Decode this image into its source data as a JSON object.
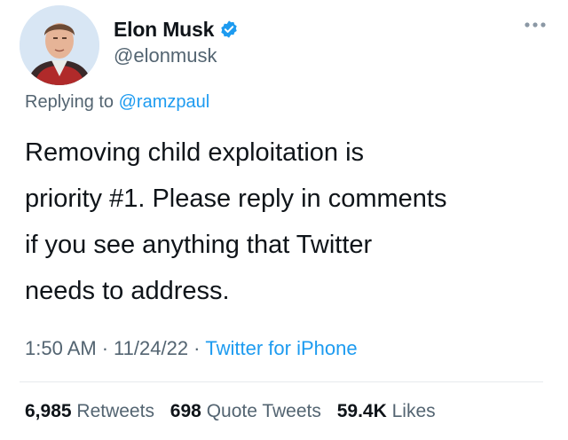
{
  "author": {
    "display_name": "Elon Musk",
    "handle": "@elonmusk",
    "verified_icon": "verified-badge-icon",
    "avatar_icon": "profile-photo"
  },
  "reply": {
    "prefix": "Replying to",
    "mention": "@ramzpaul"
  },
  "tweet": {
    "lines": [
      "Removing child exploitation is",
      "priority #1. Please reply in comments",
      "if you see anything that Twitter",
      "needs to address."
    ]
  },
  "meta": {
    "time": "1:50 AM",
    "date": "11/24/22",
    "separator": "·",
    "source": "Twitter for iPhone"
  },
  "stats": {
    "retweets_count": "6,985",
    "retweets_label": "Retweets",
    "quotes_count": "698",
    "quotes_label": "Quote Tweets",
    "likes_count": "59.4K",
    "likes_label": "Likes"
  },
  "colors": {
    "accent": "#1d9bf0",
    "muted": "#536471",
    "text": "#0f1419"
  }
}
